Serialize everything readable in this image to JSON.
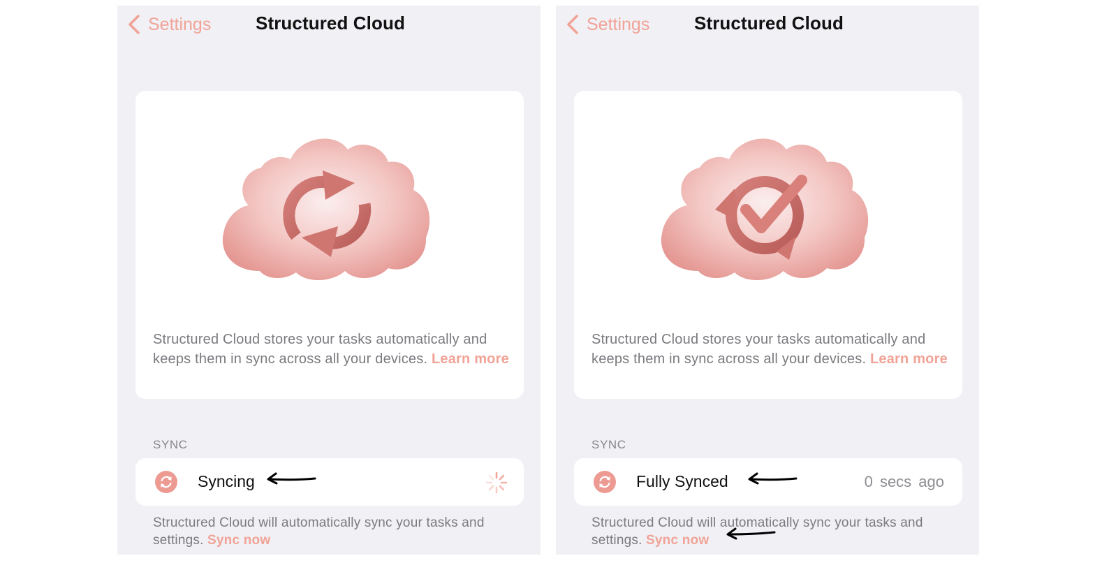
{
  "colors": {
    "accent": "#f1a397",
    "background": "#f1f0f5",
    "card": "#ffffff",
    "cloud": "#eba4a0",
    "sync_icon": "#ec9a92"
  },
  "screens": [
    {
      "nav": {
        "back_label": "Settings",
        "back_icon": "chevron-left-icon",
        "title": "Structured Cloud"
      },
      "hero": {
        "illustration": "cloud-sync-icon",
        "text": "Structured Cloud stores your tasks automatically and keeps them in sync across all your devices.",
        "link": "Learn more"
      },
      "section_label": "SYNC",
      "sync_row": {
        "icon": "sync-icon",
        "label": "Syncing",
        "indicator": "spinner-icon"
      },
      "footer": {
        "text": "Structured Cloud will automatically sync your tasks and settings.",
        "link": "Sync now"
      }
    },
    {
      "nav": {
        "back_label": "Settings",
        "back_icon": "chevron-left-icon",
        "title": "Structured Cloud"
      },
      "hero": {
        "illustration": "cloud-synced-check-icon",
        "text": "Structured Cloud stores your tasks automatically and keeps them in sync across all your devices.",
        "link": "Learn more"
      },
      "section_label": "SYNC",
      "sync_row": {
        "icon": "sync-icon",
        "label": "Fully Synced",
        "time_ago": "0 secs ago"
      },
      "footer": {
        "text": "Structured Cloud will automatically sync your tasks and settings.",
        "link": "Sync now"
      }
    }
  ]
}
